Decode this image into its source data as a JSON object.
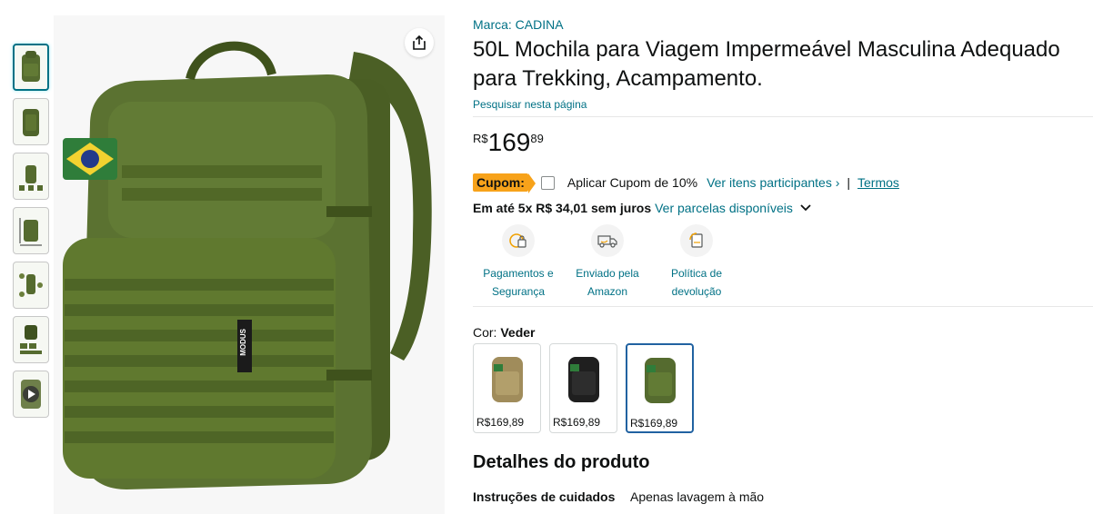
{
  "thumbnails": [
    {
      "name": "thumb-front",
      "selected": true
    },
    {
      "name": "thumb-angle"
    },
    {
      "name": "thumb-detail"
    },
    {
      "name": "thumb-size"
    },
    {
      "name": "thumb-features"
    },
    {
      "name": "thumb-pieces"
    },
    {
      "name": "thumb-video",
      "video": true
    }
  ],
  "product": {
    "brand": "Marca: CADINA",
    "title": "50L Mochila para Viagem Impermeável Masculina Adequado para Trekking, Acampamento.",
    "search_page": "Pesquisar nesta página",
    "patch_text": "MODUS"
  },
  "price": {
    "symbol": "R$",
    "whole": "169",
    "fraction": "89"
  },
  "coupon": {
    "badge": "Cupom:",
    "text": "Aplicar Cupom de 10%",
    "participants_link": "Ver itens participantes ›",
    "separator": "|",
    "terms": "Termos"
  },
  "installments": {
    "bold": "Em até 5x R$ 34,01 sem juros",
    "link": "Ver parcelas disponíveis"
  },
  "trust": [
    {
      "label": "Pagamentos e Segurança",
      "icon": "secure-payment-icon"
    },
    {
      "label": "Enviado pela Amazon",
      "icon": "delivery-truck-icon"
    },
    {
      "label": "Política de devolução",
      "icon": "return-policy-icon"
    }
  ],
  "color": {
    "label": "Cor: ",
    "value": "Veder",
    "options": [
      {
        "name": "Tan",
        "price": "R$169,89",
        "color": "#a08c5b"
      },
      {
        "name": "Black",
        "price": "R$169,89",
        "color": "#1f1f1f"
      },
      {
        "name": "Green",
        "price": "R$169,89",
        "color": "#556b2f",
        "selected": true
      }
    ]
  },
  "details": {
    "title": "Detalhes do produto",
    "rows": [
      {
        "key": "Instruções de cuidados",
        "value": "Apenas lavagem à mão"
      }
    ]
  },
  "colors": {
    "link": "#007185",
    "coupon": "#f7a21a",
    "selected_border": "#2162a1",
    "olive": "#556b2f"
  }
}
